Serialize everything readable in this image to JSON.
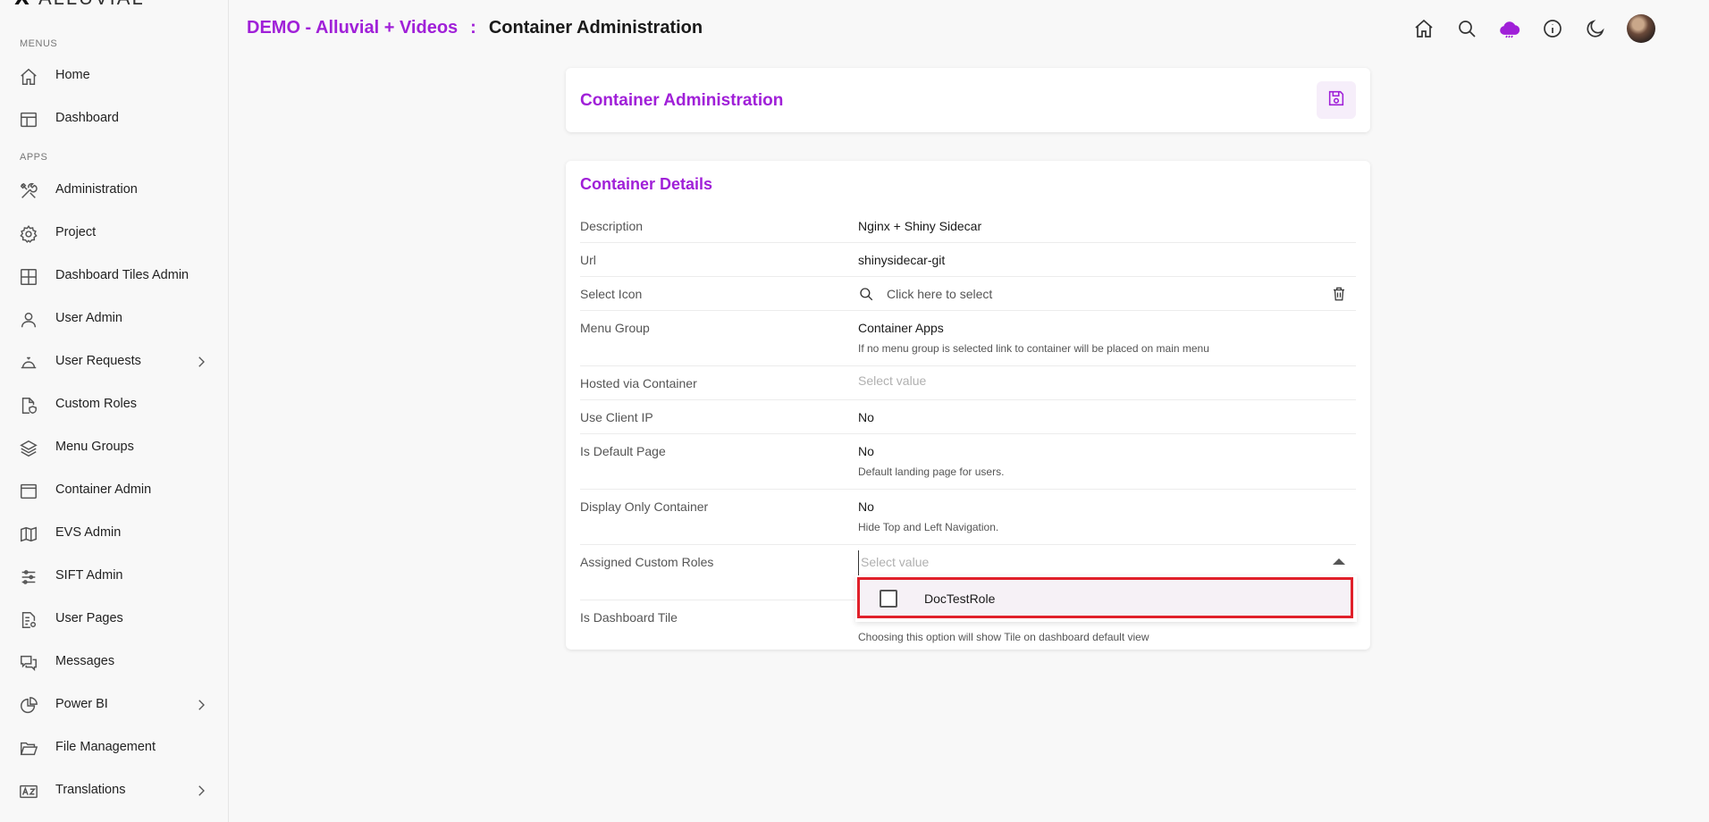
{
  "logo": {
    "mark": "X",
    "text": "ALLUVIAL"
  },
  "sidebar": {
    "menus_label": "MENUS",
    "apps_label": "APPS",
    "menus": [
      {
        "label": "Home",
        "icon": "home-icon"
      },
      {
        "label": "Dashboard",
        "icon": "dashboard-icon"
      }
    ],
    "apps": [
      {
        "label": "Administration",
        "icon": "tools-icon",
        "chevron": false
      },
      {
        "label": "Project",
        "icon": "gear-icon",
        "chevron": false
      },
      {
        "label": "Dashboard Tiles Admin",
        "icon": "grid-icon",
        "chevron": false
      },
      {
        "label": "User Admin",
        "icon": "user-icon",
        "chevron": false
      },
      {
        "label": "User Requests",
        "icon": "bell-service-icon",
        "chevron": true
      },
      {
        "label": "Custom Roles",
        "icon": "file-shield-icon",
        "chevron": false
      },
      {
        "label": "Menu Groups",
        "icon": "layers-icon",
        "chevron": false
      },
      {
        "label": "Container Admin",
        "icon": "window-icon",
        "chevron": false
      },
      {
        "label": "EVS Admin",
        "icon": "map-icon",
        "chevron": false
      },
      {
        "label": "SIFT Admin",
        "icon": "sliders-icon",
        "chevron": false
      },
      {
        "label": "User Pages",
        "icon": "file-list-icon",
        "chevron": false
      },
      {
        "label": "Messages",
        "icon": "chat-icon",
        "chevron": false
      },
      {
        "label": "Power BI",
        "icon": "pie-chart-icon",
        "chevron": true
      },
      {
        "label": "File Management",
        "icon": "folder-open-icon",
        "chevron": false
      },
      {
        "label": "Translations",
        "icon": "translate-icon",
        "chevron": true
      }
    ]
  },
  "header": {
    "app_name": "DEMO - Alluvial + Videos",
    "separator": ":",
    "page_title": "Container Administration",
    "icons": [
      "home-icon",
      "search-icon",
      "cloud-alert-icon",
      "info-icon",
      "moon-icon",
      "avatar"
    ]
  },
  "top_card": {
    "title": "Container Administration",
    "save_icon": "save-icon"
  },
  "details": {
    "title": "Container Details",
    "description": {
      "label": "Description",
      "value": "Nginx + Shiny Sidecar"
    },
    "url": {
      "label": "Url",
      "value": "shinysidecar-git"
    },
    "select_icon": {
      "label": "Select Icon",
      "placeholder": "Click here to select"
    },
    "menu_group": {
      "label": "Menu Group",
      "value": "Container Apps",
      "hint": "If no menu group is selected link to container will be placed on main menu"
    },
    "hosted_via": {
      "label": "Hosted via Container",
      "placeholder": "Select value"
    },
    "use_client_ip": {
      "label": "Use Client IP",
      "value": "No"
    },
    "is_default_page": {
      "label": "Is Default Page",
      "value": "No",
      "hint": "Default landing page for users."
    },
    "display_only": {
      "label": "Display Only Container",
      "value": "No",
      "hint": "Hide Top and Left Navigation."
    },
    "assigned_roles": {
      "label": "Assigned Custom Roles",
      "placeholder": "Select value"
    },
    "is_dashboard_tile": {
      "label": "Is Dashboard Tile",
      "hint": "Choosing this option will show Tile on dashboard default view"
    }
  },
  "dropdown": {
    "options": [
      {
        "label": "DocTestRole",
        "checked": false
      }
    ]
  },
  "colors": {
    "accent": "#a020d8",
    "highlight": "#e0202a"
  }
}
